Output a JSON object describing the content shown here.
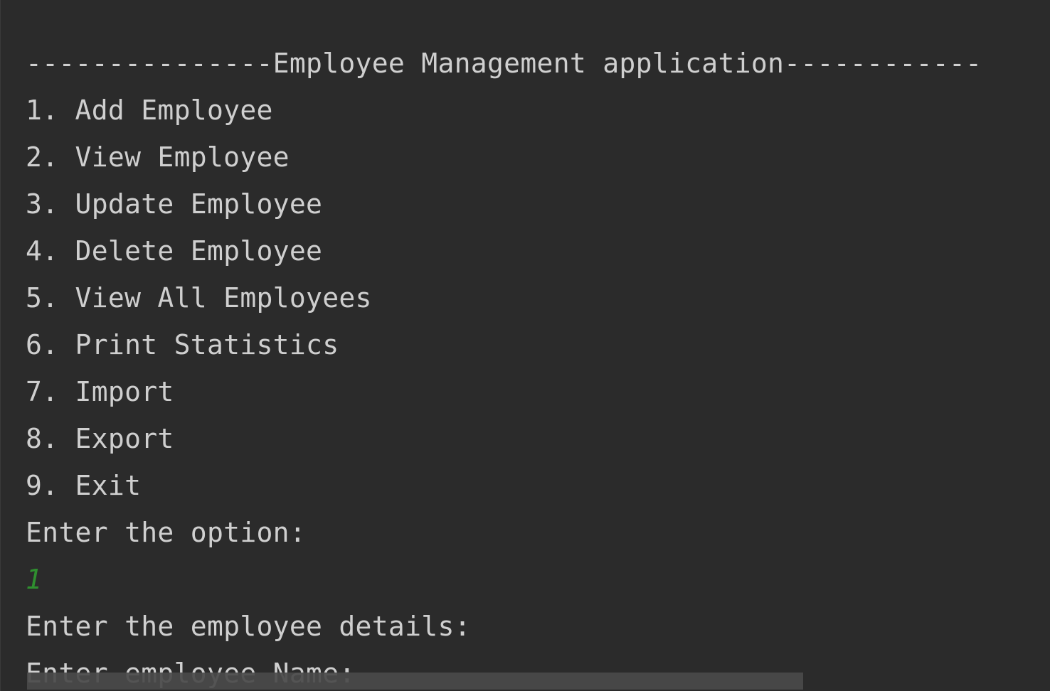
{
  "console": {
    "header": "---------------Employee Management application------------",
    "menu": [
      "1. Add Employee",
      "2. View Employee",
      "3. Update Employee",
      "4. Delete Employee",
      "5. View All Employees",
      "6. Print Statistics",
      "7. Import",
      "8. Export",
      "9. Exit"
    ],
    "option_prompt": "Enter the option:",
    "user_input": "1",
    "details_prompt": "Enter the employee details:",
    "name_prompt": "Enter employee Name:"
  },
  "colors": {
    "background": "#2b2b2b",
    "text": "#cfcfcf",
    "user_input": "#2f8f2f",
    "scrollbar": "#4a4a4a"
  }
}
